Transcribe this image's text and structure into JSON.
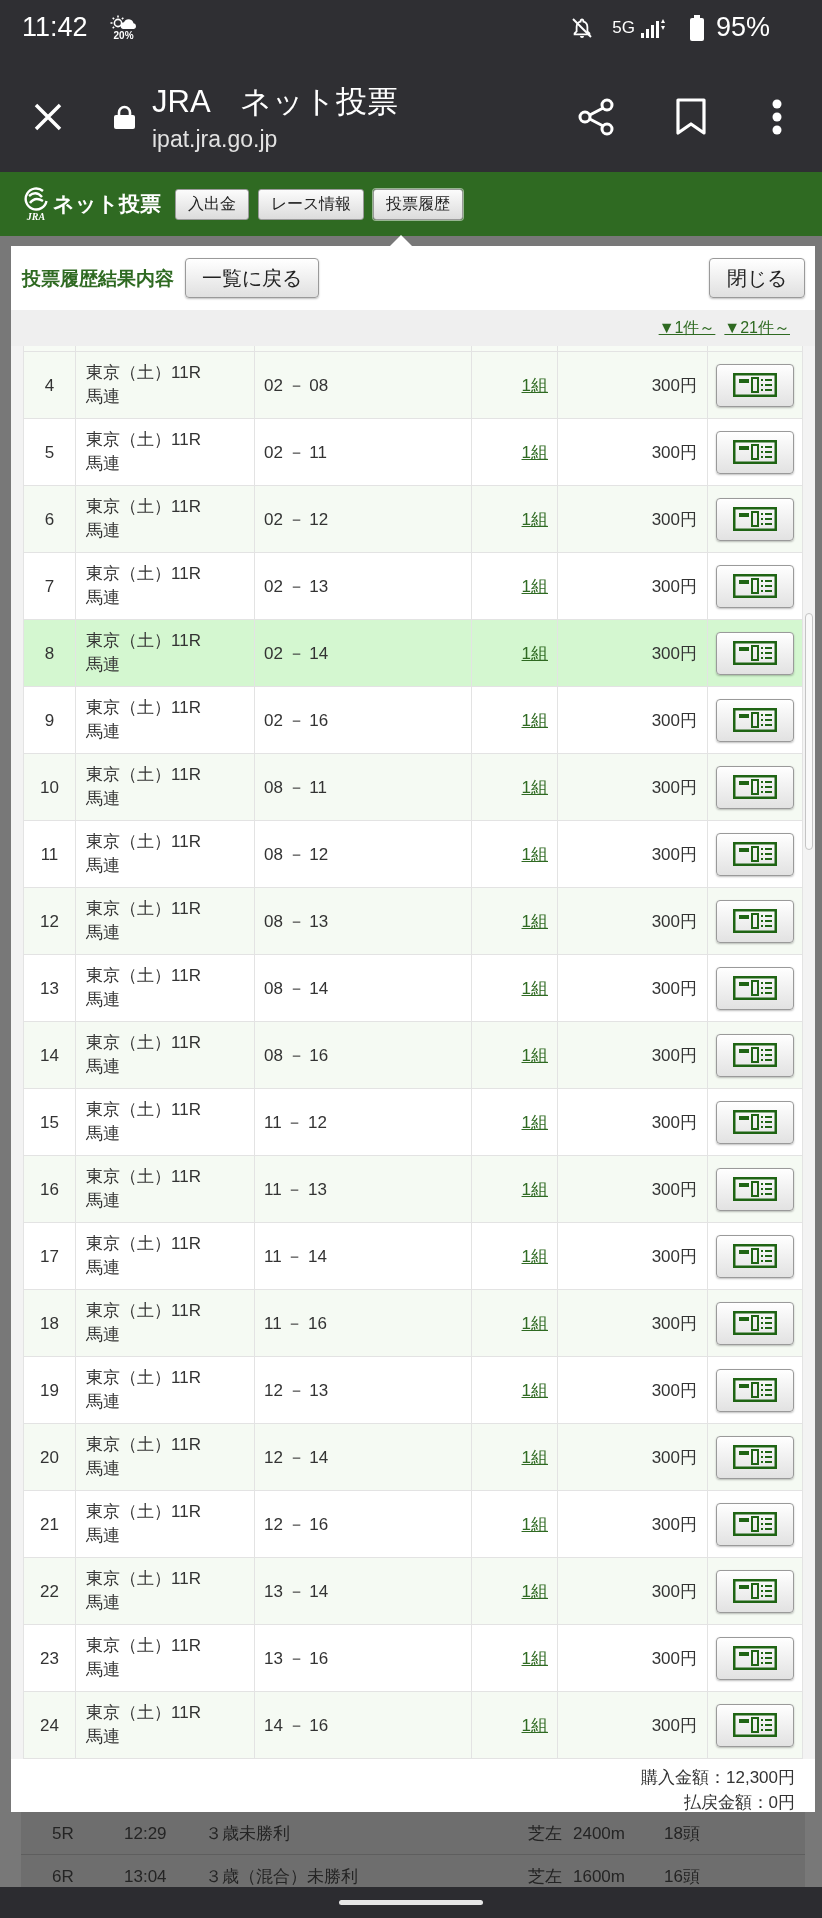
{
  "status_bar": {
    "time": "11:42",
    "weather": "20%",
    "network": "5G",
    "battery": "95%"
  },
  "browser": {
    "title": "JRA　ネット投票",
    "url": "ipat.jra.go.jp"
  },
  "nav": {
    "logo_mark": "JRA",
    "logo_text": "ネット投票",
    "tabs": [
      {
        "label": "入出金",
        "selected": false
      },
      {
        "label": "レース情報",
        "selected": false
      },
      {
        "label": "投票履歴",
        "selected": true
      }
    ]
  },
  "dialog": {
    "title": "投票履歴結果内容",
    "back_button": "一覧に戻る",
    "close_button": "閉じる",
    "page_links": [
      "▼1件～",
      "▼21件～"
    ],
    "rows": [
      {
        "no": "4",
        "venue": "東京（土）11R",
        "bet_type": "馬連",
        "combination": "02 － 08",
        "count": "1組",
        "amount": "300円",
        "selected": false
      },
      {
        "no": "5",
        "venue": "東京（土）11R",
        "bet_type": "馬連",
        "combination": "02 － 11",
        "count": "1組",
        "amount": "300円",
        "selected": false
      },
      {
        "no": "6",
        "venue": "東京（土）11R",
        "bet_type": "馬連",
        "combination": "02 － 12",
        "count": "1組",
        "amount": "300円",
        "selected": false
      },
      {
        "no": "7",
        "venue": "東京（土）11R",
        "bet_type": "馬連",
        "combination": "02 － 13",
        "count": "1組",
        "amount": "300円",
        "selected": false
      },
      {
        "no": "8",
        "venue": "東京（土）11R",
        "bet_type": "馬連",
        "combination": "02 － 14",
        "count": "1組",
        "amount": "300円",
        "selected": true
      },
      {
        "no": "9",
        "venue": "東京（土）11R",
        "bet_type": "馬連",
        "combination": "02 － 16",
        "count": "1組",
        "amount": "300円",
        "selected": false
      },
      {
        "no": "10",
        "venue": "東京（土）11R",
        "bet_type": "馬連",
        "combination": "08 － 11",
        "count": "1組",
        "amount": "300円",
        "selected": false
      },
      {
        "no": "11",
        "venue": "東京（土）11R",
        "bet_type": "馬連",
        "combination": "08 － 12",
        "count": "1組",
        "amount": "300円",
        "selected": false
      },
      {
        "no": "12",
        "venue": "東京（土）11R",
        "bet_type": "馬連",
        "combination": "08 － 13",
        "count": "1組",
        "amount": "300円",
        "selected": false
      },
      {
        "no": "13",
        "venue": "東京（土）11R",
        "bet_type": "馬連",
        "combination": "08 － 14",
        "count": "1組",
        "amount": "300円",
        "selected": false
      },
      {
        "no": "14",
        "venue": "東京（土）11R",
        "bet_type": "馬連",
        "combination": "08 － 16",
        "count": "1組",
        "amount": "300円",
        "selected": false
      },
      {
        "no": "15",
        "venue": "東京（土）11R",
        "bet_type": "馬連",
        "combination": "11 － 12",
        "count": "1組",
        "amount": "300円",
        "selected": false
      },
      {
        "no": "16",
        "venue": "東京（土）11R",
        "bet_type": "馬連",
        "combination": "11 － 13",
        "count": "1組",
        "amount": "300円",
        "selected": false
      },
      {
        "no": "17",
        "venue": "東京（土）11R",
        "bet_type": "馬連",
        "combination": "11 － 14",
        "count": "1組",
        "amount": "300円",
        "selected": false
      },
      {
        "no": "18",
        "venue": "東京（土）11R",
        "bet_type": "馬連",
        "combination": "11 － 16",
        "count": "1組",
        "amount": "300円",
        "selected": false
      },
      {
        "no": "19",
        "venue": "東京（土）11R",
        "bet_type": "馬連",
        "combination": "12 － 13",
        "count": "1組",
        "amount": "300円",
        "selected": false
      },
      {
        "no": "20",
        "venue": "東京（土）11R",
        "bet_type": "馬連",
        "combination": "12 － 14",
        "count": "1組",
        "amount": "300円",
        "selected": false
      },
      {
        "no": "21",
        "venue": "東京（土）11R",
        "bet_type": "馬連",
        "combination": "12 － 16",
        "count": "1組",
        "amount": "300円",
        "selected": false
      },
      {
        "no": "22",
        "venue": "東京（土）11R",
        "bet_type": "馬連",
        "combination": "13 － 14",
        "count": "1組",
        "amount": "300円",
        "selected": false
      },
      {
        "no": "23",
        "venue": "東京（土）11R",
        "bet_type": "馬連",
        "combination": "13 － 16",
        "count": "1組",
        "amount": "300円",
        "selected": false
      },
      {
        "no": "24",
        "venue": "東京（土）11R",
        "bet_type": "馬連",
        "combination": "14 － 16",
        "count": "1組",
        "amount": "300円",
        "selected": false
      }
    ],
    "totals": [
      "購入金額：12,300円",
      "払戻金額：0円"
    ]
  },
  "background_rows": [
    {
      "race": "5R",
      "time": "12:29",
      "name": "３歳未勝利",
      "course": "芝左",
      "distance": "2400m",
      "runners": "18頭"
    },
    {
      "race": "6R",
      "time": "13:04",
      "name": "３歳（混合）未勝利",
      "course": "芝左",
      "distance": "1600m",
      "runners": "16頭"
    }
  ]
}
